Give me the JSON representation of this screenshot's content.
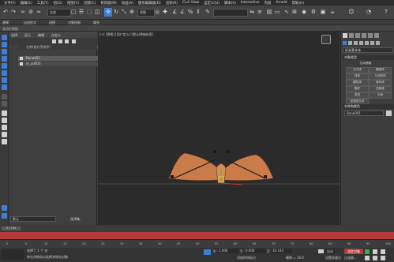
{
  "app": {
    "menus": [
      "文件(F)",
      "编辑(E)",
      "工具(T)",
      "组(G)",
      "视图(V)",
      "创建(C)",
      "修改器(M)",
      "动画(A)",
      "图形编辑器(D)",
      "渲染(R)",
      "Civil View",
      "自定义(U)",
      "脚本(S)",
      "Interactive",
      "内容",
      "Arnold",
      "帮助(H)"
    ],
    "selection_filter": "全部",
    "view_dropdown": "视图"
  },
  "ribbon": {
    "row1": [
      "建模",
      "自由形式",
      "选择",
      "对象绘制",
      "填充"
    ],
    "row2_label": "多边形建模"
  },
  "scene_explorer": {
    "tabs": [
      "选择",
      "显示",
      "编辑",
      "自定义"
    ],
    "header_name": "名称(按升序排序)",
    "header_frozen": "冻结",
    "items": [
      {
        "name": "Bone001"
      },
      {
        "name": "m_ad003"
      }
    ],
    "layer_label": "默认",
    "selection_set_label": "选择集:"
  },
  "viewport": {
    "label": "[+] [透视] [用户定义] [默认明暗处理]",
    "tool_icon_label": "Front"
  },
  "command_panel": {
    "dropdown": "标准基本体",
    "rollout_object_type": "对象类型",
    "autogrid": "自动栅格",
    "buttons": [
      "长方体",
      "圆锥体",
      "球体",
      "几何球体",
      "圆柱体",
      "管状体",
      "圆环",
      "四棱锥",
      "茶壶",
      "平面",
      "加强型文本"
    ],
    "rollout_name_color": "名称和颜色",
    "name_value": "Bone001",
    "name_color": "#c8c8c8"
  },
  "timeline": {
    "frame_display": "0 / 100",
    "ticks": [
      "0",
      "5",
      "10",
      "15",
      "20",
      "25",
      "30",
      "35",
      "40",
      "45",
      "50",
      "55",
      "60",
      "65",
      "70",
      "75",
      "80",
      "85",
      "90",
      "95",
      "100"
    ]
  },
  "status": {
    "selection": "选择了 1 个 对",
    "hint": "单击并拖动以选择并移动对象",
    "x_label": "X:",
    "x_value": "1.000",
    "y_label": "Y:",
    "y_value": "0.000",
    "z_label": "Z:",
    "z_value": "10.143",
    "grid": "栅格 = 10.0",
    "add_time_tag": "添加时间标记",
    "auto_key": "自动",
    "set_key": "设置关键点",
    "selected_label": "选定对象",
    "key_filters": "过滤器..."
  },
  "colors": {
    "accent": "#3e7fd6",
    "timeline_red": "#b33a3a",
    "bone_orange": "#c97b4a"
  }
}
